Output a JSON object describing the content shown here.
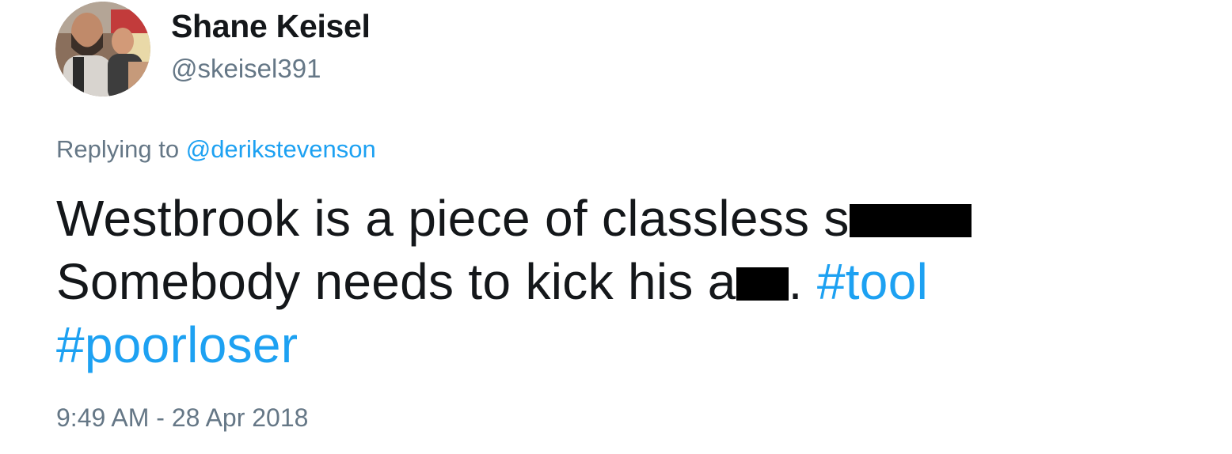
{
  "author": {
    "display_name": "Shane Keisel",
    "handle": "@skeisel391"
  },
  "reply": {
    "prefix": "Replying to",
    "mention": "@derikstevenson"
  },
  "tweet": {
    "line1_text": "Westbrook is a piece of classless s",
    "line2_text_a": "Somebody needs to kick his a",
    "line2_text_b": ". ",
    "hashtag1": "#tool",
    "hashtag2": "#poorloser"
  },
  "timestamp": "9:49 AM - 28 Apr 2018",
  "colors": {
    "link": "#1da1f2",
    "secondary_text": "#657786",
    "primary_text": "#14171a",
    "redaction": "#000000"
  },
  "icons": {
    "avatar": "profile-photo"
  }
}
